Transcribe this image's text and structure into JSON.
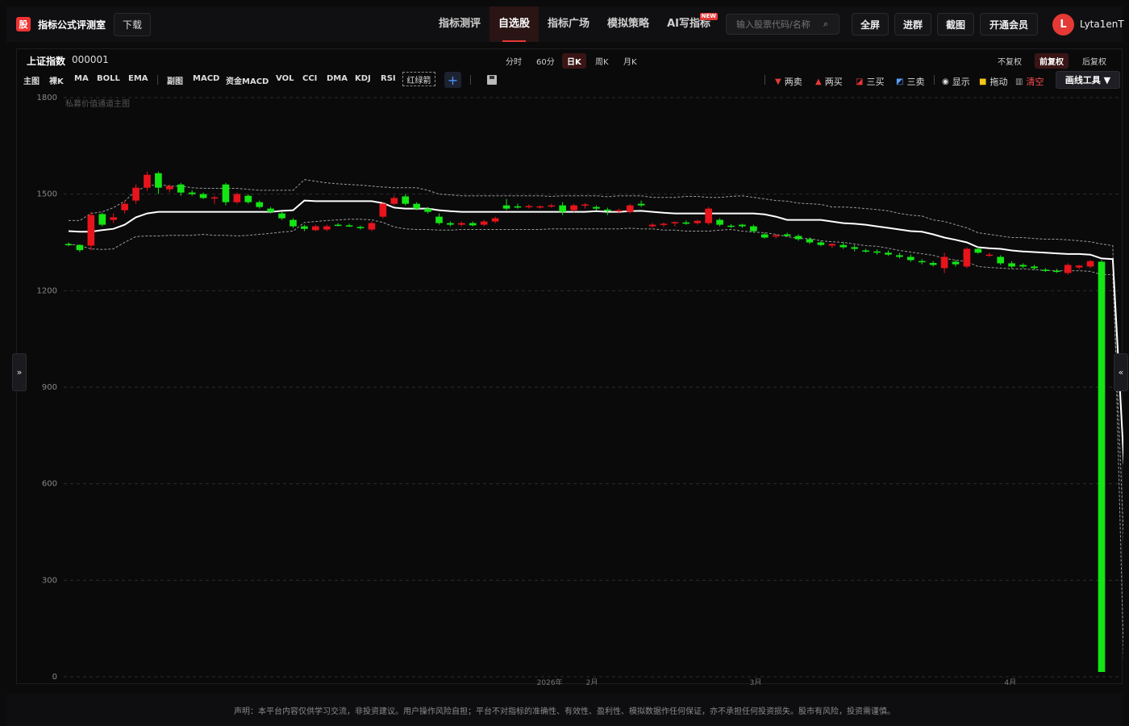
{
  "topbar": {
    "logo_glyph": "股",
    "app_title": "指标公式评测室",
    "download_label": "下载",
    "nav": [
      {
        "label": "指标测评",
        "active": false
      },
      {
        "label": "自选股",
        "active": true
      },
      {
        "label": "指标广场",
        "active": false
      },
      {
        "label": "模拟策略",
        "active": false
      },
      {
        "label": "AI写指标",
        "active": false,
        "badge": "NEW"
      }
    ],
    "search_placeholder": "输入股票代码/名称",
    "buttons": {
      "fullscreen": "全屏",
      "join_group": "进群",
      "screenshot": "截图",
      "membership": "开通会员"
    },
    "avatar_letter": "L",
    "username": "Lyta1enT"
  },
  "ticker": {
    "name": "上证指数",
    "code": "000001"
  },
  "periods": [
    {
      "label": "分时",
      "active": false
    },
    {
      "label": "60分",
      "active": false
    },
    {
      "label": "日K",
      "active": true
    },
    {
      "label": "周K",
      "active": false
    },
    {
      "label": "月K",
      "active": false
    }
  ],
  "adjust": [
    {
      "label": "不复权",
      "active": false
    },
    {
      "label": "前复权",
      "active": true
    },
    {
      "label": "后复权",
      "active": false
    }
  ],
  "main_indicators": [
    "主图",
    "裸K",
    "MA",
    "BOLL",
    "EMA"
  ],
  "sub_indicators": [
    "副图",
    "MACD",
    "资金MACD",
    "VOL",
    "CCI",
    "DMA",
    "KDJ",
    "RSI"
  ],
  "red_green_label": "红绿箭",
  "draw_tools": {
    "two_sell": "两卖",
    "two_buy": "两买",
    "three_buy": "三买",
    "three_sell": "三卖",
    "show": "显示",
    "drag": "拖动",
    "clear": "清空",
    "tools": "画线工具 ▼"
  },
  "chart_data": {
    "type": "candlestick",
    "title": "私募价值通道主图",
    "ylim": [
      0,
      1800
    ],
    "yticks": [
      0,
      300,
      600,
      900,
      1200,
      1500,
      1800
    ],
    "x_labels": [
      "2026年",
      "2月",
      "3月",
      "4月"
    ],
    "colors": {
      "up": "#e8141c",
      "down": "#14e614",
      "mid": "#ffffff",
      "band": "#9a9a9a",
      "grid": "#2c2c2c"
    },
    "candles": [
      [
        1345,
        1350,
        1338,
        1342
      ],
      [
        1342,
        1344,
        1320,
        1326
      ],
      [
        1340,
        1445,
        1325,
        1435
      ],
      [
        1438,
        1442,
        1400,
        1405
      ],
      [
        1420,
        1440,
        1410,
        1428
      ],
      [
        1450,
        1480,
        1440,
        1470
      ],
      [
        1480,
        1530,
        1470,
        1520
      ],
      [
        1520,
        1570,
        1510,
        1560
      ],
      [
        1565,
        1570,
        1500,
        1520
      ],
      [
        1515,
        1530,
        1505,
        1525
      ],
      [
        1530,
        1535,
        1495,
        1505
      ],
      [
        1505,
        1512,
        1495,
        1500
      ],
      [
        1500,
        1505,
        1485,
        1488
      ],
      [
        1490,
        1495,
        1470,
        1490
      ],
      [
        1530,
        1535,
        1465,
        1475
      ],
      [
        1475,
        1505,
        1470,
        1500
      ],
      [
        1495,
        1500,
        1470,
        1475
      ],
      [
        1475,
        1480,
        1455,
        1460
      ],
      [
        1455,
        1460,
        1440,
        1445
      ],
      [
        1440,
        1445,
        1420,
        1425
      ],
      [
        1420,
        1425,
        1395,
        1400
      ],
      [
        1400,
        1405,
        1385,
        1392
      ],
      [
        1388,
        1405,
        1385,
        1400
      ],
      [
        1390,
        1405,
        1385,
        1400
      ],
      [
        1405,
        1410,
        1400,
        1403
      ],
      [
        1403,
        1408,
        1398,
        1402
      ],
      [
        1398,
        1402,
        1390,
        1395
      ],
      [
        1390,
        1415,
        1385,
        1410
      ],
      [
        1430,
        1475,
        1425,
        1470
      ],
      [
        1470,
        1495,
        1465,
        1488
      ],
      [
        1493,
        1500,
        1465,
        1470
      ],
      [
        1470,
        1475,
        1450,
        1455
      ],
      [
        1455,
        1460,
        1440,
        1445
      ],
      [
        1430,
        1440,
        1405,
        1410
      ],
      [
        1410,
        1415,
        1400,
        1405
      ],
      [
        1405,
        1415,
        1400,
        1410
      ],
      [
        1410,
        1415,
        1400,
        1403
      ],
      [
        1405,
        1420,
        1400,
        1415
      ],
      [
        1415,
        1430,
        1410,
        1425
      ],
      [
        1465,
        1485,
        1450,
        1455
      ],
      [
        1462,
        1470,
        1455,
        1460
      ],
      [
        1460,
        1468,
        1455,
        1463
      ],
      [
        1460,
        1465,
        1455,
        1462
      ],
      [
        1462,
        1470,
        1458,
        1465
      ],
      [
        1465,
        1475,
        1435,
        1445
      ],
      [
        1450,
        1470,
        1445,
        1465
      ],
      [
        1465,
        1472,
        1455,
        1468
      ],
      [
        1460,
        1465,
        1450,
        1455
      ],
      [
        1452,
        1458,
        1435,
        1448
      ],
      [
        1448,
        1455,
        1440,
        1450
      ],
      [
        1445,
        1470,
        1440,
        1465
      ],
      [
        1470,
        1480,
        1460,
        1465
      ],
      [
        1400,
        1410,
        1395,
        1405
      ],
      [
        1405,
        1412,
        1398,
        1408
      ],
      [
        1410,
        1415,
        1400,
        1413
      ],
      [
        1412,
        1418,
        1405,
        1408
      ],
      [
        1410,
        1420,
        1405,
        1417
      ],
      [
        1410,
        1460,
        1405,
        1455
      ],
      [
        1420,
        1425,
        1400,
        1405
      ],
      [
        1402,
        1407,
        1395,
        1400
      ],
      [
        1405,
        1408,
        1395,
        1400
      ],
      [
        1400,
        1405,
        1380,
        1385
      ],
      [
        1375,
        1380,
        1362,
        1365
      ],
      [
        1370,
        1376,
        1362,
        1372
      ],
      [
        1375,
        1380,
        1368,
        1370
      ],
      [
        1370,
        1375,
        1355,
        1360
      ],
      [
        1360,
        1365,
        1345,
        1350
      ],
      [
        1350,
        1355,
        1338,
        1342
      ],
      [
        1340,
        1348,
        1332,
        1345
      ],
      [
        1342,
        1350,
        1330,
        1335
      ],
      [
        1335,
        1342,
        1322,
        1330
      ],
      [
        1325,
        1330,
        1318,
        1322
      ],
      [
        1322,
        1328,
        1312,
        1318
      ],
      [
        1318,
        1325,
        1308,
        1312
      ],
      [
        1310,
        1318,
        1300,
        1305
      ],
      [
        1305,
        1312,
        1290,
        1295
      ],
      [
        1292,
        1298,
        1282,
        1290
      ],
      [
        1286,
        1292,
        1275,
        1280
      ],
      [
        1270,
        1318,
        1255,
        1305
      ],
      [
        1290,
        1295,
        1275,
        1282
      ],
      [
        1275,
        1335,
        1270,
        1330
      ],
      [
        1330,
        1335,
        1315,
        1318
      ],
      [
        1310,
        1318,
        1305,
        1312
      ],
      [
        1305,
        1310,
        1280,
        1285
      ],
      [
        1285,
        1292,
        1270,
        1275
      ],
      [
        1280,
        1285,
        1270,
        1275
      ],
      [
        1275,
        1280,
        1265,
        1270
      ],
      [
        1265,
        1270,
        1258,
        1262
      ],
      [
        1262,
        1268,
        1255,
        1260
      ],
      [
        1255,
        1285,
        1250,
        1280
      ],
      [
        1272,
        1280,
        1266,
        1278
      ],
      [
        1275,
        1295,
        1270,
        1292
      ],
      [
        1290,
        1295,
        15,
        15
      ]
    ],
    "mid_line": [
      1385,
      1383,
      1383,
      1388,
      1392,
      1405,
      1428,
      1440,
      1445,
      1445,
      1445,
      1445,
      1445,
      1445,
      1445,
      1445,
      1445,
      1445,
      1445,
      1448,
      1450,
      1480,
      1478,
      1478,
      1478,
      1478,
      1478,
      1478,
      1472,
      1458,
      1455,
      1455,
      1455,
      1450,
      1447,
      1445,
      1445,
      1445,
      1445,
      1445,
      1445,
      1445,
      1445,
      1445,
      1445,
      1445,
      1445,
      1447,
      1445,
      1445,
      1447,
      1448,
      1445,
      1442,
      1440,
      1440,
      1440,
      1440,
      1440,
      1440,
      1440,
      1440,
      1437,
      1430,
      1420,
      1420,
      1420,
      1420,
      1415,
      1410,
      1408,
      1405,
      1400,
      1395,
      1390,
      1385,
      1383,
      1375,
      1365,
      1358,
      1350,
      1335,
      1332,
      1330,
      1325,
      1322,
      1320,
      1318,
      1316,
      1314,
      1314,
      1312,
      1300,
      1298,
      660
    ],
    "upper_band": [
      1418,
      1418,
      1440,
      1445,
      1458,
      1478,
      1510,
      1525,
      1530,
      1525,
      1525,
      1520,
      1518,
      1518,
      1518,
      1518,
      1515,
      1512,
      1512,
      1512,
      1512,
      1545,
      1540,
      1535,
      1532,
      1530,
      1528,
      1525,
      1522,
      1520,
      1520,
      1520,
      1512,
      1500,
      1498,
      1495,
      1495,
      1495,
      1495,
      1495,
      1495,
      1495,
      1495,
      1493,
      1495,
      1495,
      1495,
      1495,
      1492,
      1495,
      1495,
      1495,
      1490,
      1490,
      1490,
      1493,
      1493,
      1490,
      1490,
      1493,
      1495,
      1490,
      1485,
      1480,
      1478,
      1472,
      1470,
      1468,
      1460,
      1460,
      1458,
      1455,
      1452,
      1448,
      1440,
      1435,
      1432,
      1420,
      1415,
      1405,
      1395,
      1380,
      1375,
      1370,
      1365,
      1365,
      1362,
      1360,
      1360,
      1358,
      1355,
      1352,
      1345,
      1340,
      20
    ],
    "lower_band": [
      1345,
      1340,
      1330,
      1328,
      1330,
      1350,
      1368,
      1370,
      1370,
      1372,
      1372,
      1372,
      1375,
      1372,
      1372,
      1370,
      1372,
      1375,
      1378,
      1382,
      1385,
      1412,
      1415,
      1418,
      1420,
      1422,
      1422,
      1420,
      1412,
      1398,
      1392,
      1390,
      1390,
      1388,
      1388,
      1390,
      1390,
      1390,
      1390,
      1390,
      1390,
      1390,
      1390,
      1392,
      1392,
      1392,
      1392,
      1392,
      1392,
      1392,
      1394,
      1392,
      1392,
      1388,
      1388,
      1385,
      1385,
      1385,
      1388,
      1390,
      1385,
      1382,
      1380,
      1375,
      1368,
      1362,
      1362,
      1355,
      1352,
      1350,
      1345,
      1340,
      1338,
      1332,
      1325,
      1320,
      1315,
      1310,
      1300,
      1295,
      1290,
      1275,
      1272,
      1270,
      1268,
      1268,
      1265,
      1263,
      1262,
      1262,
      1262,
      1260,
      1250,
      1250,
      400
    ]
  },
  "side_toggle_left": "»",
  "side_toggle_right": "«",
  "footer_text": "声明：本平台内容仅供学习交流，非投资建议。用户操作风险自担；平台不对指标的准确性、有效性、盈利性、模拟数据作任何保证，亦不承担任何投资损失。股市有风险，投资需谨慎。"
}
